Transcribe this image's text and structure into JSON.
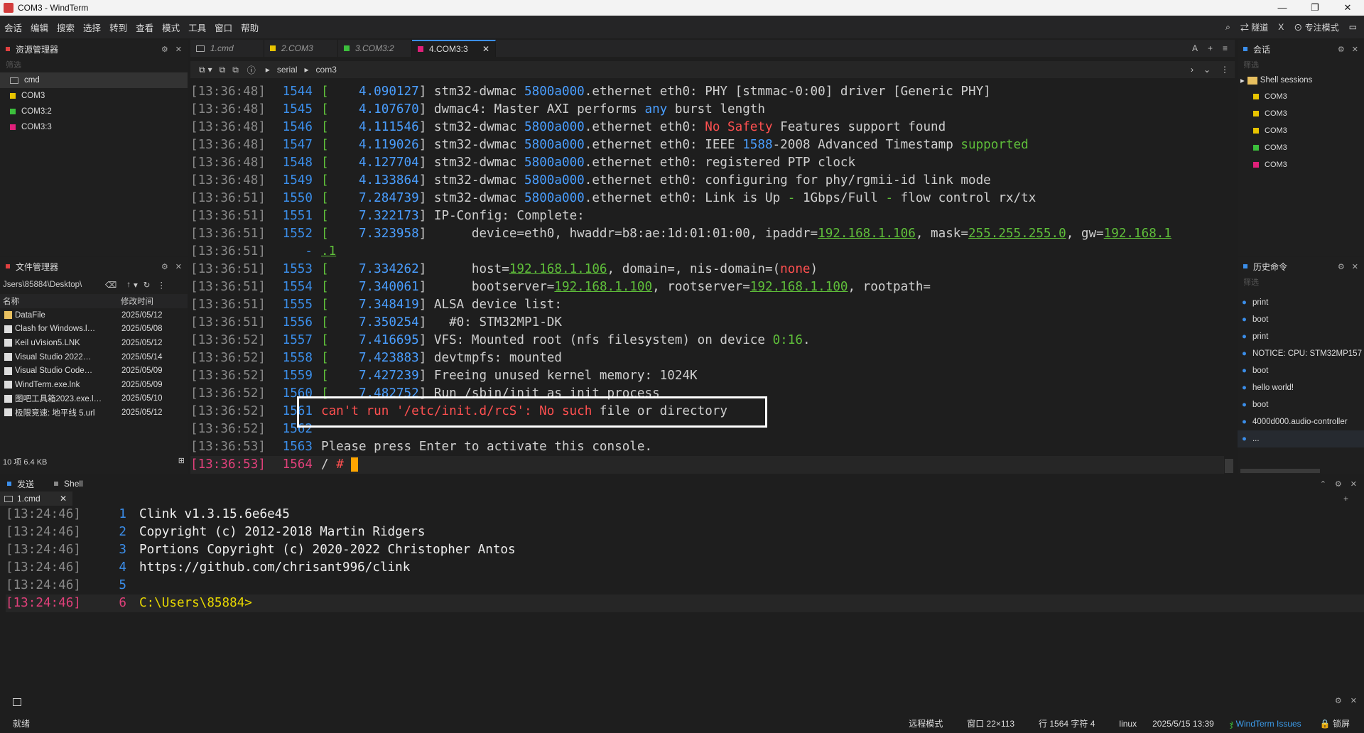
{
  "window": {
    "title": "COM3 - WindTerm"
  },
  "menu": [
    "会话",
    "编辑",
    "搜索",
    "选择",
    "转到",
    "查看",
    "模式",
    "工具",
    "窗口",
    "帮助"
  ],
  "menu_right": {
    "tunnel": "隧道",
    "x": "X",
    "focus": "专注模式"
  },
  "explorer": {
    "title": "资源管理器",
    "filter": "筛选",
    "items": [
      {
        "label": "cmd",
        "color": ""
      },
      {
        "label": "COM3",
        "color": "#e8c400"
      },
      {
        "label": "COM3:2",
        "color": "#3cbf3c"
      },
      {
        "label": "COM3:3",
        "color": "#e0207a"
      }
    ]
  },
  "files": {
    "title": "文件管理器",
    "path": "Jsers\\85884\\Desktop\\",
    "col_name": "名称",
    "col_time": "修改时间",
    "rows": [
      {
        "name": "DataFile",
        "time": "2025/05/12"
      },
      {
        "name": "Clash for Windows.l…",
        "time": "2025/05/08"
      },
      {
        "name": "Keil uVision5.LNK",
        "time": "2025/05/12"
      },
      {
        "name": "Visual Studio 2022…",
        "time": "2025/05/14"
      },
      {
        "name": "Visual Studio Code…",
        "time": "2025/05/09"
      },
      {
        "name": "WindTerm.exe.lnk",
        "time": "2025/05/09"
      },
      {
        "name": "图吧工具箱2023.exe.l…",
        "time": "2025/05/10"
      },
      {
        "name": "极限竞速: 地平线 5.url",
        "time": "2025/05/12"
      }
    ],
    "summary": "10 项 6.4 KB"
  },
  "tabs": [
    {
      "label": "1.cmd",
      "color": ""
    },
    {
      "label": "2.COM3",
      "color": "#e8c400"
    },
    {
      "label": "3.COM3:2",
      "color": "#3cbf3c"
    },
    {
      "label": "4.COM3:3",
      "color": "#e0207a"
    }
  ],
  "toolbar": {
    "crumb1": "serial",
    "crumb2": "com3"
  },
  "terminal": {
    "lines": [
      {
        "ts": "[13:36:48]",
        "ln": "1544",
        "segs": [
          [
            "[    ",
            "g"
          ],
          [
            "4.090127",
            "b"
          ],
          [
            "] stm32-dwmac ",
            ""
          ],
          [
            "5800a000",
            "b"
          ],
          [
            ".ethernet eth0: PHY [stmmac-0:00] driver [Generic PHY]",
            ""
          ]
        ]
      },
      {
        "ts": "[13:36:48]",
        "ln": "1545",
        "segs": [
          [
            "[    ",
            "g"
          ],
          [
            "4.107670",
            "b"
          ],
          [
            "] dwmac4: Master AXI performs ",
            ""
          ],
          [
            "any",
            "b"
          ],
          [
            " burst length",
            ""
          ]
        ]
      },
      {
        "ts": "[13:36:48]",
        "ln": "1546",
        "segs": [
          [
            "[    ",
            "g"
          ],
          [
            "4.111546",
            "b"
          ],
          [
            "] stm32-dwmac ",
            ""
          ],
          [
            "5800a000",
            "b"
          ],
          [
            ".ethernet eth0: ",
            ""
          ],
          [
            "No Safety",
            "r"
          ],
          [
            " Features support found",
            ""
          ]
        ]
      },
      {
        "ts": "[13:36:48]",
        "ln": "1547",
        "segs": [
          [
            "[    ",
            "g"
          ],
          [
            "4.119026",
            "b"
          ],
          [
            "] stm32-dwmac ",
            ""
          ],
          [
            "5800a000",
            "b"
          ],
          [
            ".ethernet eth0: IEEE ",
            ""
          ],
          [
            "1588",
            "b"
          ],
          [
            "-2008 Advanced Timestamp ",
            ""
          ],
          [
            "supported",
            "g"
          ]
        ]
      },
      {
        "ts": "[13:36:48]",
        "ln": "1548",
        "segs": [
          [
            "[    ",
            "g"
          ],
          [
            "4.127704",
            "b"
          ],
          [
            "] stm32-dwmac ",
            ""
          ],
          [
            "5800a000",
            "b"
          ],
          [
            ".ethernet eth0: registered PTP clock",
            ""
          ]
        ]
      },
      {
        "ts": "[13:36:48]",
        "ln": "1549",
        "segs": [
          [
            "[    ",
            "g"
          ],
          [
            "4.133864",
            "b"
          ],
          [
            "] stm32-dwmac ",
            ""
          ],
          [
            "5800a000",
            "b"
          ],
          [
            ".ethernet eth0: configuring for phy/rgmii-id link mode",
            ""
          ]
        ]
      },
      {
        "ts": "[13:36:51]",
        "ln": "1550",
        "segs": [
          [
            "[    ",
            "g"
          ],
          [
            "7.284739",
            "b"
          ],
          [
            "] stm32-dwmac ",
            ""
          ],
          [
            "5800a000",
            "b"
          ],
          [
            ".ethernet eth0: Link is Up ",
            ""
          ],
          [
            "-",
            "g"
          ],
          [
            " 1Gbps/Full ",
            ""
          ],
          [
            "-",
            "g"
          ],
          [
            " flow control rx/tx",
            ""
          ]
        ]
      },
      {
        "ts": "[13:36:51]",
        "ln": "1551",
        "segs": [
          [
            "[    ",
            "g"
          ],
          [
            "7.322173",
            "b"
          ],
          [
            "] IP-Config: Complete:",
            ""
          ]
        ]
      },
      {
        "ts": "[13:36:51]",
        "ln": "1552",
        "segs": [
          [
            "[    ",
            "g"
          ],
          [
            "7.323958",
            "b"
          ],
          [
            "]      device=eth0, hwaddr=b8:ae:1d:01:01:00, ipaddr=",
            ""
          ],
          [
            "192.168.1.106",
            "gu"
          ],
          [
            ", mask=",
            ""
          ],
          [
            "255.255.255.0",
            "gu"
          ],
          [
            ", gw=",
            ""
          ],
          [
            "192.168.1",
            "gu"
          ]
        ]
      },
      {
        "ts": "[13:36:51]",
        "ln": "-",
        "segs": [
          [
            ".1",
            "gu"
          ]
        ]
      },
      {
        "ts": "[13:36:51]",
        "ln": "1553",
        "segs": [
          [
            "[    ",
            "g"
          ],
          [
            "7.334262",
            "b"
          ],
          [
            "]      host=",
            ""
          ],
          [
            "192.168.1.106",
            "gu"
          ],
          [
            ", domain=, nis-domain=(",
            ""
          ],
          [
            "none",
            "r"
          ],
          [
            ")",
            ""
          ]
        ]
      },
      {
        "ts": "[13:36:51]",
        "ln": "1554",
        "segs": [
          [
            "[    ",
            "g"
          ],
          [
            "7.340061",
            "b"
          ],
          [
            "]      bootserver=",
            ""
          ],
          [
            "192.168.1.100",
            "gu"
          ],
          [
            ", rootserver=",
            ""
          ],
          [
            "192.168.1.100",
            "gu"
          ],
          [
            ", rootpath=",
            ""
          ]
        ]
      },
      {
        "ts": "[13:36:51]",
        "ln": "1555",
        "segs": [
          [
            "[    ",
            "g"
          ],
          [
            "7.348419",
            "b"
          ],
          [
            "] ALSA device list:",
            ""
          ]
        ]
      },
      {
        "ts": "[13:36:51]",
        "ln": "1556",
        "segs": [
          [
            "[    ",
            "g"
          ],
          [
            "7.350254",
            "b"
          ],
          [
            "]   #0: STM32MP1-DK",
            ""
          ]
        ]
      },
      {
        "ts": "[13:36:52]",
        "ln": "1557",
        "segs": [
          [
            "[    ",
            "g"
          ],
          [
            "7.416695",
            "b"
          ],
          [
            "] VFS: Mounted root (nfs filesystem) on device ",
            ""
          ],
          [
            "0:16",
            "g"
          ],
          [
            ".",
            ""
          ]
        ]
      },
      {
        "ts": "[13:36:52]",
        "ln": "1558",
        "segs": [
          [
            "[    ",
            "g"
          ],
          [
            "7.423883",
            "b"
          ],
          [
            "] devtmpfs: mounted",
            ""
          ]
        ]
      },
      {
        "ts": "[13:36:52]",
        "ln": "1559",
        "segs": [
          [
            "[    ",
            "g"
          ],
          [
            "7.427239",
            "b"
          ],
          [
            "] Freeing unused kernel memory: 1024K",
            ""
          ]
        ]
      },
      {
        "ts": "[13:36:52]",
        "ln": "1560",
        "segs": [
          [
            "[    ",
            "g"
          ],
          [
            "7.482752",
            "b"
          ],
          [
            "] Run /sbin/init as init process",
            ""
          ]
        ]
      },
      {
        "ts": "[13:36:52]",
        "ln": "1561",
        "segs": [
          [
            "can't run '/etc/init.d/rcS': No such",
            "r"
          ],
          [
            " file or directory",
            ""
          ]
        ]
      },
      {
        "ts": "[13:36:52]",
        "ln": "1562",
        "segs": []
      },
      {
        "ts": "[13:36:53]",
        "ln": "1563",
        "segs": [
          [
            "Please press Enter to activate this console.",
            ""
          ]
        ]
      },
      {
        "ts": "[13:36:53]",
        "ln": "1564",
        "segs": [
          [
            "/ ",
            ""
          ],
          [
            "#",
            "r"
          ],
          [
            " ",
            ""
          ]
        ],
        "current": true
      }
    ]
  },
  "sessions": {
    "title": "会话",
    "filter": "筛选",
    "group": "Shell sessions",
    "items": [
      {
        "label": "COM3",
        "color": "#e8c400"
      },
      {
        "label": "COM3",
        "color": "#e8c400"
      },
      {
        "label": "COM3",
        "color": "#e8c400"
      },
      {
        "label": "COM3",
        "color": "#3cbf3c"
      },
      {
        "label": "COM3",
        "color": "#e0207a"
      }
    ]
  },
  "history": {
    "title": "历史命令",
    "filter": "筛选",
    "items": [
      "print",
      "boot",
      "print",
      "NOTICE: CPU: STM32MP157",
      "boot",
      "hello world!",
      "boot",
      "4000d000.audio-controller",
      "..."
    ]
  },
  "bottom": {
    "tab_send": "发送",
    "tab_shell": "Shell",
    "subtab": "1.cmd",
    "lines": [
      {
        "ts": "[13:24:46]",
        "ln": "1",
        "text": "Clink v1.3.15.6e6e45"
      },
      {
        "ts": "[13:24:46]",
        "ln": "2",
        "text": "Copyright (c) 2012-2018 Martin Ridgers"
      },
      {
        "ts": "[13:24:46]",
        "ln": "3",
        "text": "Portions Copyright (c) 2020-2022 Christopher Antos"
      },
      {
        "ts": "[13:24:46]",
        "ln": "4",
        "text": "https://github.com/chrisant996/clink"
      },
      {
        "ts": "[13:24:46]",
        "ln": "5",
        "text": ""
      },
      {
        "ts": "[13:24:46]",
        "ln": "6",
        "text": "C:\\Users\\85884>"
      }
    ]
  },
  "status": {
    "ready": "就绪",
    "mode": "远程模式",
    "window": "窗口 22×113",
    "pos": "行 1564 字符 4",
    "os": "linux",
    "datetime": "2025/5/15 13:39",
    "issues": "WindTerm Issues",
    "lock": "锁屏"
  }
}
